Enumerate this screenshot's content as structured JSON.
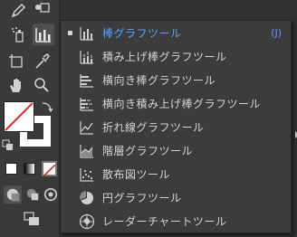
{
  "toolbar": {
    "tools": [
      {
        "name": "pencil-tool",
        "icon": "pencil-icon"
      },
      {
        "name": "shape-builder-tool",
        "icon": "shape-builder-icon"
      },
      {
        "name": "symbol-sprayer-tool",
        "icon": "symbol-sprayer-icon"
      },
      {
        "name": "graph-tool",
        "icon": "bar-chart-icon"
      },
      {
        "name": "artboard-tool",
        "icon": "artboard-icon"
      },
      {
        "name": "eyedropper-tool",
        "icon": "eyedropper-icon"
      },
      {
        "name": "hand-tool",
        "icon": "hand-icon"
      },
      {
        "name": "zoom-tool",
        "icon": "magnifier-icon"
      }
    ],
    "fill_stroke": {
      "fill": "#ffffff",
      "stroke": "#ffffff",
      "none_color": "#e02020"
    }
  },
  "flyout": {
    "items": [
      {
        "label": "棒グラフツール",
        "shortcut": "(J)",
        "selected": true,
        "icon": "column-graph-icon"
      },
      {
        "label": "積み上げ棒グラフツール",
        "shortcut": "",
        "selected": false,
        "icon": "stacked-column-graph-icon"
      },
      {
        "label": "横向き棒グラフツール",
        "shortcut": "",
        "selected": false,
        "icon": "bar-graph-icon"
      },
      {
        "label": "横向き積み上げ棒グラフツール",
        "shortcut": "",
        "selected": false,
        "icon": "stacked-bar-graph-icon"
      },
      {
        "label": "折れ線グラフツール",
        "shortcut": "",
        "selected": false,
        "icon": "line-graph-icon"
      },
      {
        "label": "階層グラフツール",
        "shortcut": "",
        "selected": false,
        "icon": "area-graph-icon"
      },
      {
        "label": "散布図ツール",
        "shortcut": "",
        "selected": false,
        "icon": "scatter-graph-icon"
      },
      {
        "label": "円グラフツール",
        "shortcut": "",
        "selected": false,
        "icon": "pie-graph-icon"
      },
      {
        "label": "レーダーチャートツール",
        "shortcut": "",
        "selected": false,
        "icon": "radar-graph-icon"
      }
    ],
    "accent_color": "#5aa1ff"
  }
}
